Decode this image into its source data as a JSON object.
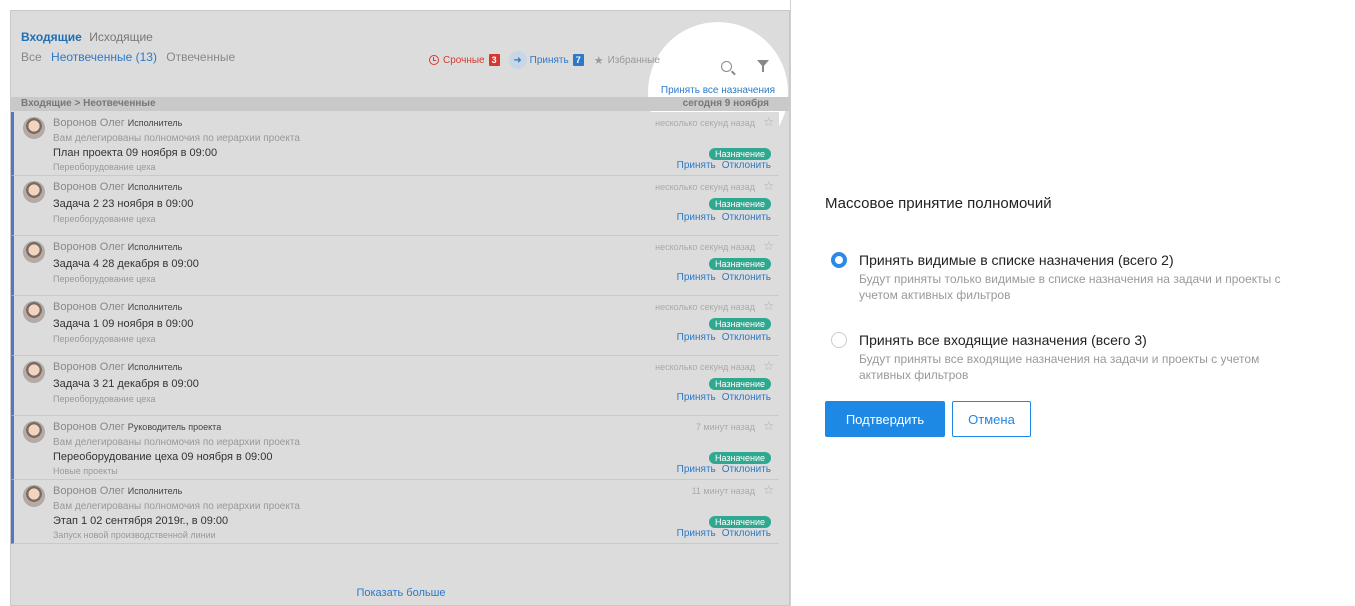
{
  "inbox": {
    "tabs": [
      "Входящие",
      "Исходящие"
    ],
    "subtabs": {
      "all": "Все",
      "unanswered": "Неотвеченные (13)",
      "answered": "Отвеченные"
    },
    "filters": {
      "urgent_label": "Срочные",
      "urgent_count": "3",
      "accept_label": "Принять",
      "accept_count": "7",
      "favorites_label": "Избранные"
    },
    "accept_all_link": "Принять все назначения",
    "breadcrumb": "Входящие > Неотвеченные",
    "date_header": "сегодня 9 ноября",
    "items": [
      {
        "name": "Воронов Олег",
        "role": "Исполнитель",
        "delegated": "Вам делегированы полномочия по иерархии проекта",
        "task": "План проекта 09 ноября в 09:00",
        "project": "Переоборудование цеха",
        "time": "несколько секунд назад",
        "tag": "Назначение",
        "accept": "Принять",
        "decline": "Отклонить"
      },
      {
        "name": "Воронов Олег",
        "role": "Исполнитель",
        "task": "Задача 2 23 ноября в 09:00",
        "project": "Переоборудование цеха",
        "time": "несколько секунд назад",
        "tag": "Назначение",
        "accept": "Принять",
        "decline": "Отклонить"
      },
      {
        "name": "Воронов Олег",
        "role": "Исполнитель",
        "task": "Задача 4 28 декабря в 09:00",
        "project": "Переоборудование цеха",
        "time": "несколько секунд назад",
        "tag": "Назначение",
        "accept": "Принять",
        "decline": "Отклонить"
      },
      {
        "name": "Воронов Олег",
        "role": "Исполнитель",
        "task": "Задача 1 09 ноября в 09:00",
        "project": "Переоборудование цеха",
        "time": "несколько секунд назад",
        "tag": "Назначение",
        "accept": "Принять",
        "decline": "Отклонить"
      },
      {
        "name": "Воронов Олег",
        "role": "Исполнитель",
        "task": "Задача 3 21 декабря в 09:00",
        "project": "Переоборудование цеха",
        "time": "несколько секунд назад",
        "tag": "Назначение",
        "accept": "Принять",
        "decline": "Отклонить"
      },
      {
        "name": "Воронов Олег",
        "role": "Руководитель проекта",
        "delegated": "Вам делегированы полномочия по иерархии проекта",
        "task": "Переоборудование цеха 09 ноября в 09:00",
        "project": "Новые проекты",
        "time": "7 минут назад",
        "tag": "Назначение",
        "accept": "Принять",
        "decline": "Отклонить"
      },
      {
        "name": "Воронов Олег",
        "role": "Исполнитель",
        "delegated": "Вам делегированы полномочия по иерархии проекта",
        "task": "Этап 1 02 сентября 2019г., в 09:00",
        "project": "Запуск новой производственной линии",
        "time": "11 минут назад",
        "tag": "Назначение",
        "accept": "Принять",
        "decline": "Отклонить"
      }
    ],
    "show_more": "Показать больше"
  },
  "dialog": {
    "title": "Массовое принятие полномочий",
    "option1_label": "Принять видимые в списке назначения (всего 2)",
    "option1_desc": "Будут приняты только видимые в списке назначения на задачи и проекты с учетом активных фильтров",
    "option2_label": "Принять все входящие назначения (всего 3)",
    "option2_desc": "Будут приняты все входящие назначения на задачи и проекты с учетом активных фильтров",
    "confirm": "Подтвердить",
    "cancel": "Отмена"
  },
  "colors": {
    "accent": "#1e88e5",
    "urgent": "#d23a2f",
    "tag": "#2ea88f"
  }
}
